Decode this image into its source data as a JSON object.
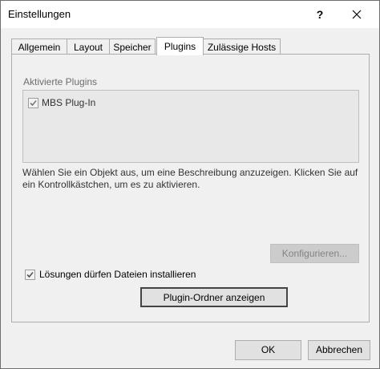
{
  "window": {
    "title": "Einstellungen",
    "help_label": "?",
    "close_label": "✕"
  },
  "tabs": [
    {
      "label": "Allgemein",
      "active": false
    },
    {
      "label": "Layout",
      "active": false
    },
    {
      "label": "Speicher",
      "active": false
    },
    {
      "label": "Plugins",
      "active": true
    },
    {
      "label": "Zulässige Hosts",
      "active": false
    }
  ],
  "plugins": {
    "section_label": "Aktivierte Plugins",
    "items": [
      {
        "label": "MBS Plug-In",
        "checked": true
      }
    ],
    "description": "Wählen Sie ein Objekt aus, um eine Beschreibung anzuzeigen. Klicken Sie auf ein Kontrollkästchen, um es zu aktivieren.",
    "configure_label": "Konfigurieren...",
    "solutions_checkbox_label": "Lösungen dürfen Dateien installieren",
    "solutions_checked": true,
    "show_folder_label": "Plugin-Ordner anzeigen"
  },
  "footer": {
    "ok_label": "OK",
    "cancel_label": "Abbrechen"
  }
}
